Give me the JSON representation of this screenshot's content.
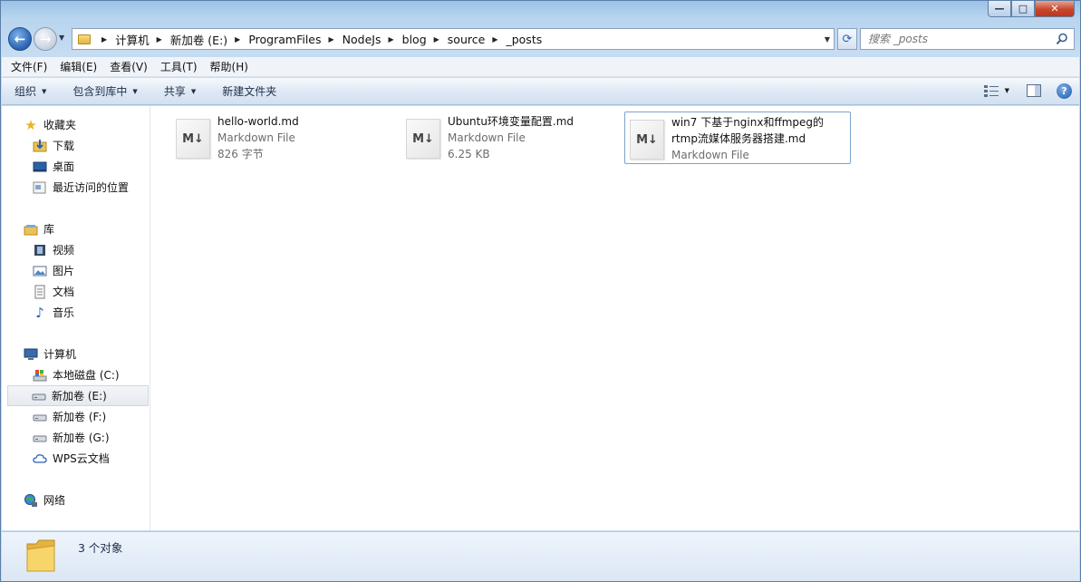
{
  "window": {
    "caption_buttons": {
      "minimize": "—",
      "maximize": "□",
      "close": "✕"
    }
  },
  "nav": {
    "back_icon": "back-arrow-icon",
    "forward_icon": "forward-arrow-icon",
    "breadcrumb": [
      "计算机",
      "新加卷 (E:)",
      "ProgramFiles",
      "NodeJs",
      "blog",
      "source",
      "_posts"
    ],
    "search_placeholder": "搜索 _posts"
  },
  "menubar": {
    "items": [
      "文件(F)",
      "编辑(E)",
      "查看(V)",
      "工具(T)",
      "帮助(H)"
    ]
  },
  "cmdbar": {
    "organize": "组织",
    "include_library": "包含到库中",
    "share": "共享",
    "new_folder": "新建文件夹"
  },
  "sidebar": {
    "favorites": {
      "label": "收藏夹",
      "items": [
        "下载",
        "桌面",
        "最近访问的位置"
      ]
    },
    "libraries": {
      "label": "库",
      "items": [
        "视频",
        "图片",
        "文档",
        "音乐"
      ]
    },
    "computer": {
      "label": "计算机",
      "items": [
        "本地磁盘 (C:)",
        "新加卷 (E:)",
        "新加卷 (F:)",
        "新加卷 (G:)",
        "WPS云文档"
      ],
      "selected": "新加卷 (E:)"
    },
    "network": {
      "label": "网络"
    }
  },
  "files": [
    {
      "name": "hello-world.md",
      "type": "Markdown File",
      "size": "826 字节",
      "icon": "M↓"
    },
    {
      "name": "Ubuntu环境变量配置.md",
      "type": "Markdown File",
      "size": "6.25 KB",
      "icon": "M↓"
    },
    {
      "name_line1": "win7 下基于nginx和ffmpeg的",
      "name_line2": "rtmp流媒体服务器搭建.md",
      "type": "Markdown File",
      "icon": "M↓"
    }
  ],
  "status": {
    "count": "3 个对象"
  },
  "colors": {
    "accent": "#2a62b2",
    "selection_border": "#7da2ce",
    "window_frame": "#b9d5ef"
  }
}
